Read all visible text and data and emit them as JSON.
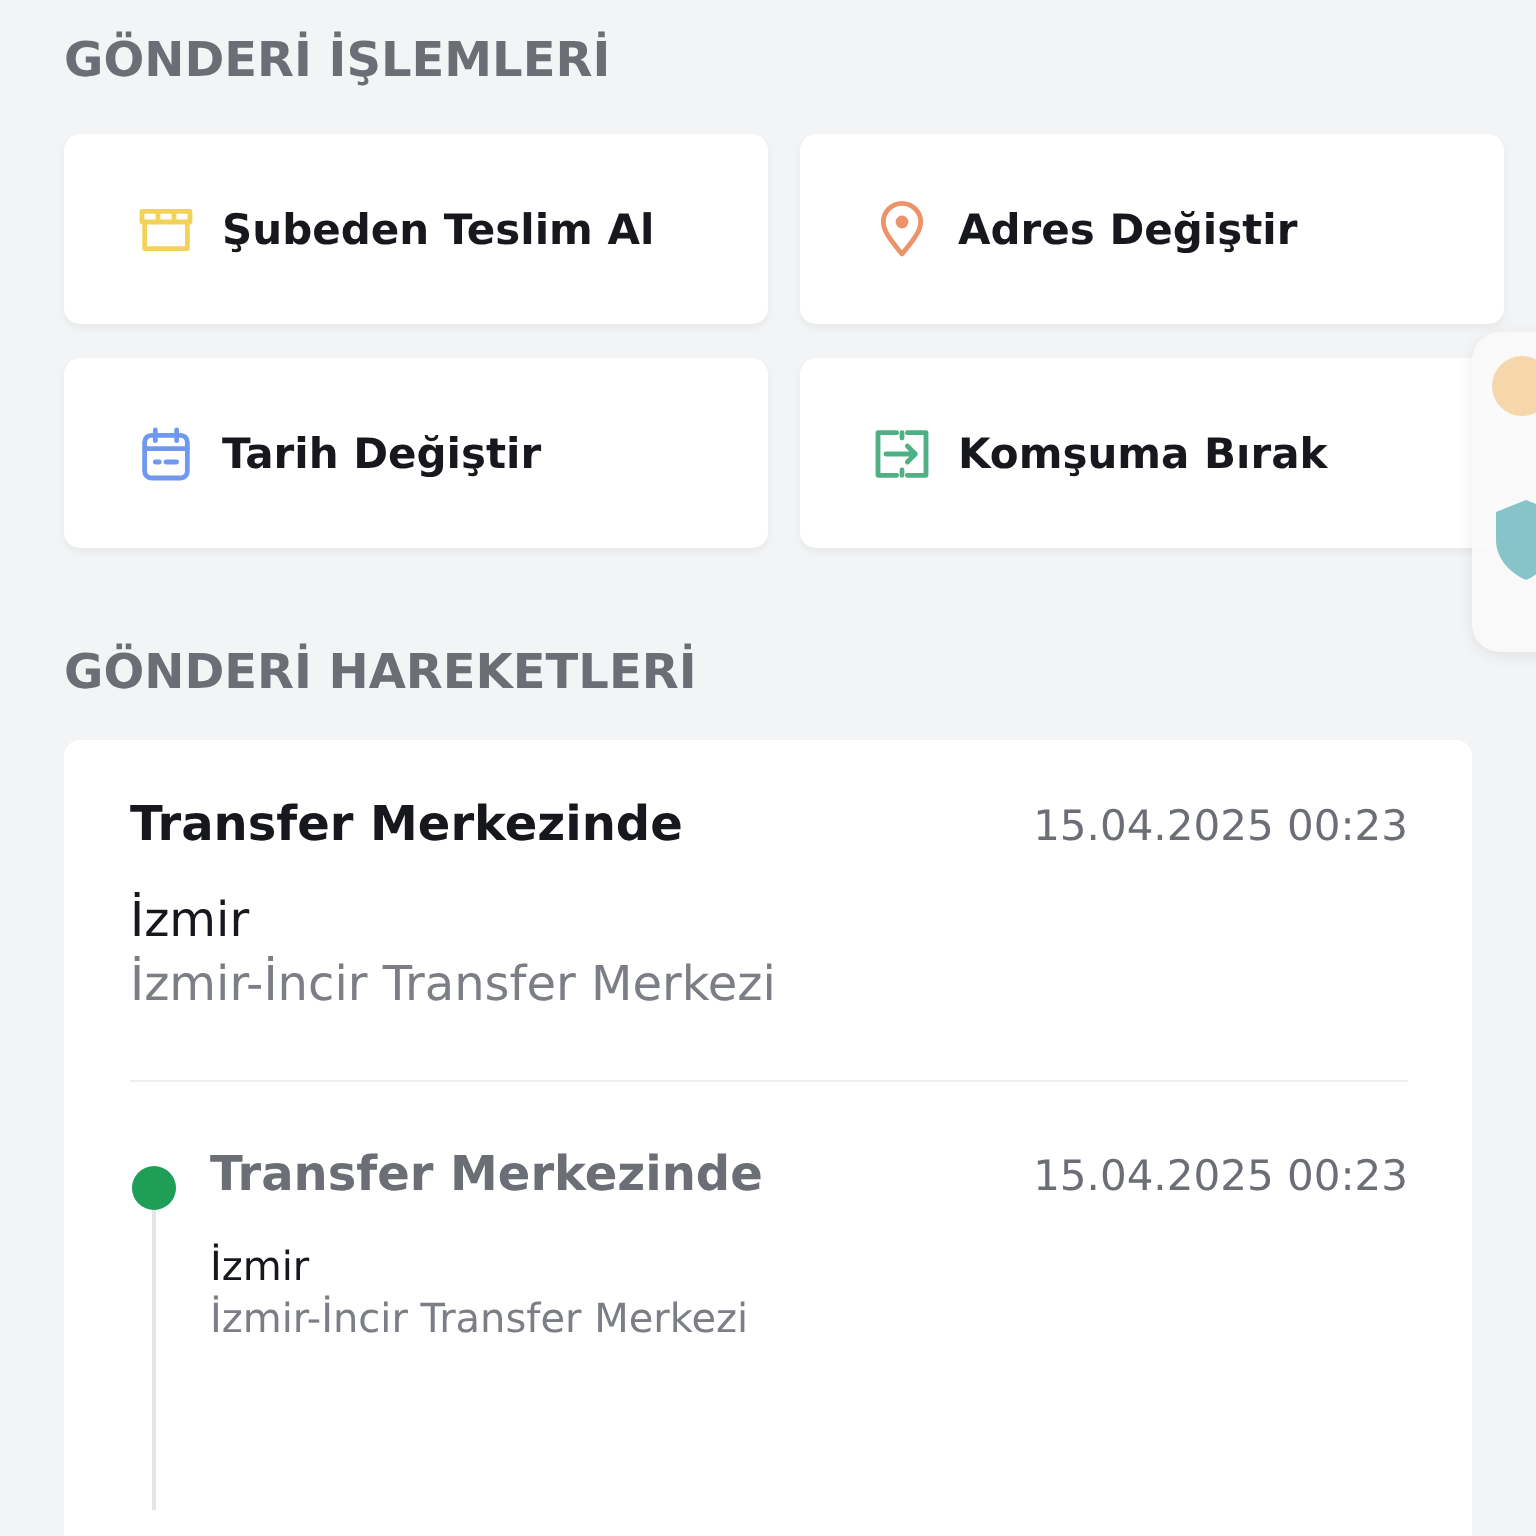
{
  "operations": {
    "title": "GÖNDERİ İŞLEMLERİ",
    "actions": [
      {
        "kind": "store",
        "label": "Şubeden Teslim Al"
      },
      {
        "kind": "pin",
        "label": "Adres Değiştir"
      },
      {
        "kind": "calendar",
        "label": "Tarih Değiştir"
      },
      {
        "kind": "swap",
        "label": "Komşuma Bırak"
      }
    ]
  },
  "movements": {
    "title": "GÖNDERİ HAREKETLERİ",
    "latest": {
      "status": "Transfer Merkezinde",
      "datetime": "15.04.2025 00:23",
      "city": "İzmir",
      "location": "İzmir-İncir Transfer Merkezi"
    },
    "timeline": [
      {
        "status": "Transfer Merkezinde",
        "datetime": "15.04.2025 00:23",
        "city": "İzmir",
        "location": "İzmir-İncir Transfer Merkezi"
      }
    ]
  }
}
